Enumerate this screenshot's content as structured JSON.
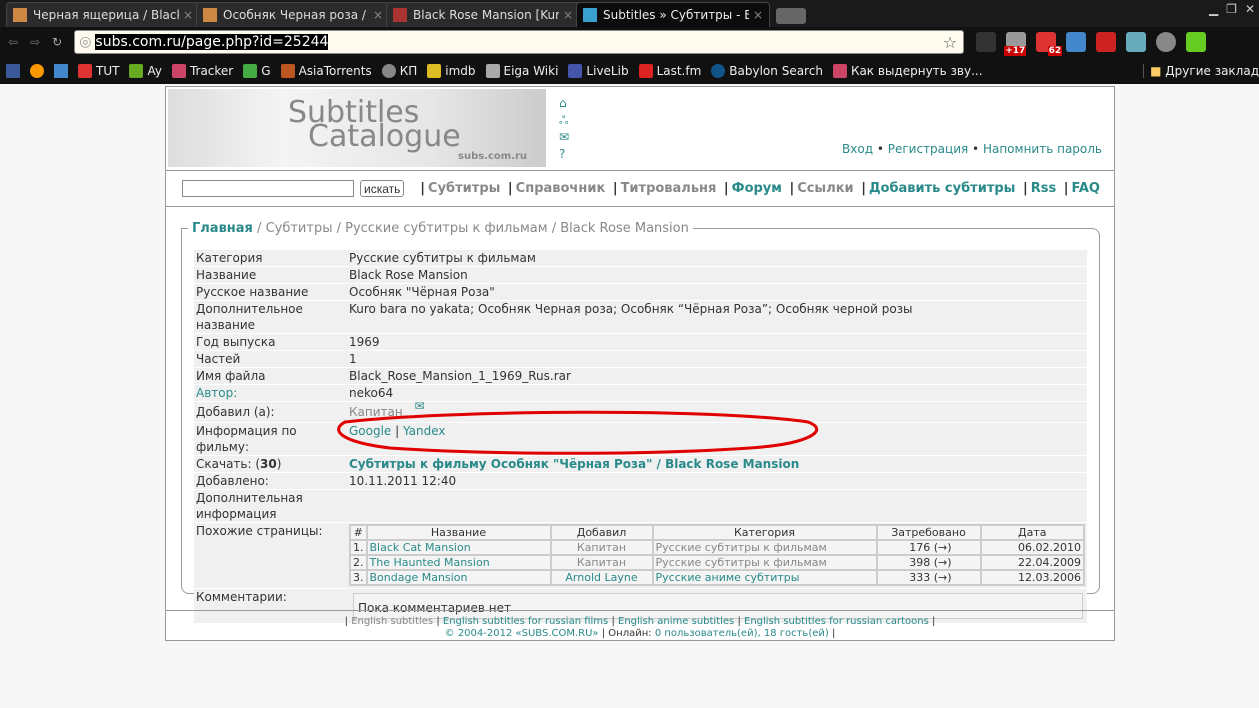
{
  "browser": {
    "tabs": [
      {
        "title": "Черная ящерица / Black L"
      },
      {
        "title": "Особняк Черная роза / E"
      },
      {
        "title": "Black Rose Mansion [Kuro"
      },
      {
        "title": "Subtitles » Субтитры - Bla"
      }
    ],
    "url_host": "subs.com.ru/page.php?id=25244",
    "extensions": [
      {
        "badge": "+17"
      },
      {
        "badge": "62"
      }
    ],
    "bookmarks": [
      "TUT",
      "Ay",
      "Tracker",
      "G",
      "AsiaTorrents",
      "КП",
      "imdb",
      "Eiga Wiki",
      "LiveLib",
      "Last.fm",
      "Babylon Search",
      "Как выдернуть зву..."
    ],
    "other_bookmarks": "Другие заклад"
  },
  "logo": {
    "line1": "Subtitles",
    "line2": "Catalogue",
    "domain": "subs.com.ru"
  },
  "auth": {
    "login": "Вход",
    "register": "Регистрация",
    "remind": "Напомнить пароль"
  },
  "search": {
    "value": "",
    "button": "искать"
  },
  "menu": [
    "Субтитры",
    "Справочник",
    "Титровальня",
    "Форум",
    "Ссылки",
    "Добавить субтитры",
    "Rss",
    "FAQ"
  ],
  "breadcrumb": {
    "home": "Главная",
    "items": [
      "Субтитры",
      "Русские субтитры к фильмам",
      "Black Rose Mansion"
    ]
  },
  "info": {
    "category": {
      "k": "Категория",
      "v": "Русские субтитры к фильмам"
    },
    "name": {
      "k": "Название",
      "v": "Black Rose Mansion"
    },
    "ru_name": {
      "k": "Русское название",
      "v": "Особняк \"Чёрная Роза\""
    },
    "alt_name": {
      "k": "Дополнительное название",
      "v": "Kuro bara no yakata; Особняк Черная роза; Особняк “Чёрная Роза”; Особняк черной розы"
    },
    "year": {
      "k": "Год выпуска",
      "v": "1969"
    },
    "parts": {
      "k": "Частей",
      "v": "1"
    },
    "file": {
      "k": "Имя файла",
      "v": "Black_Rose_Mansion_1_1969_Rus.rar"
    },
    "author": {
      "k": "Автор:",
      "v": "neko64"
    },
    "added_by": {
      "k": "Добавил (а):",
      "v": "Капитан"
    },
    "film_info": {
      "k": "Информация по фильму:",
      "google": "Google",
      "yandex": "Yandex"
    },
    "download": {
      "k": "Скачать: (",
      "count": "30",
      "k2": ")",
      "v": "Субтитры к фильму Особняк \"Чёрная Роза\" / Black Rose Mansion"
    },
    "added": {
      "k": "Добавлено:",
      "v": "10.11.2011 12:40"
    },
    "extra": {
      "k": "Дополнительная информация"
    },
    "similar": {
      "k": "Похожие страницы:"
    },
    "comments": {
      "k": "Комментарии:",
      "v": "Пока комментариев нет"
    }
  },
  "similar": {
    "headers": [
      "#",
      "Название",
      "Добавил",
      "Категория",
      "Затребовано",
      "Дата"
    ],
    "rows": [
      {
        "n": "1.",
        "title": "Black Cat Mansion",
        "by": "Капитан",
        "cat": "Русские субтитры к фильмам",
        "req": "176 (→)",
        "date": "06.02.2010"
      },
      {
        "n": "2.",
        "title": "The Haunted Mansion",
        "by": "Капитан",
        "cat": "Русские субтитры к фильмам",
        "req": "398 (→)",
        "date": "22.04.2009"
      },
      {
        "n": "3.",
        "title": "Bondage Mansion",
        "by": "Arnold Layne",
        "cat": "Русские аниме субтитры",
        "req": "333 (→)",
        "date": "12.03.2006"
      }
    ]
  },
  "footer": {
    "links": [
      "English subtitles",
      "English subtitles for russian films",
      "English anime subtitles",
      "English subtitles for russian cartoons"
    ],
    "copyright": "© 2004-2012 «SUBS.COM.RU»",
    "online_label": "Онлайн:",
    "online": "0 пользователь(ей), 18 гость(ей)"
  },
  "colors": {
    "accent": "#2a8a8a",
    "highlight": "#e00000"
  }
}
